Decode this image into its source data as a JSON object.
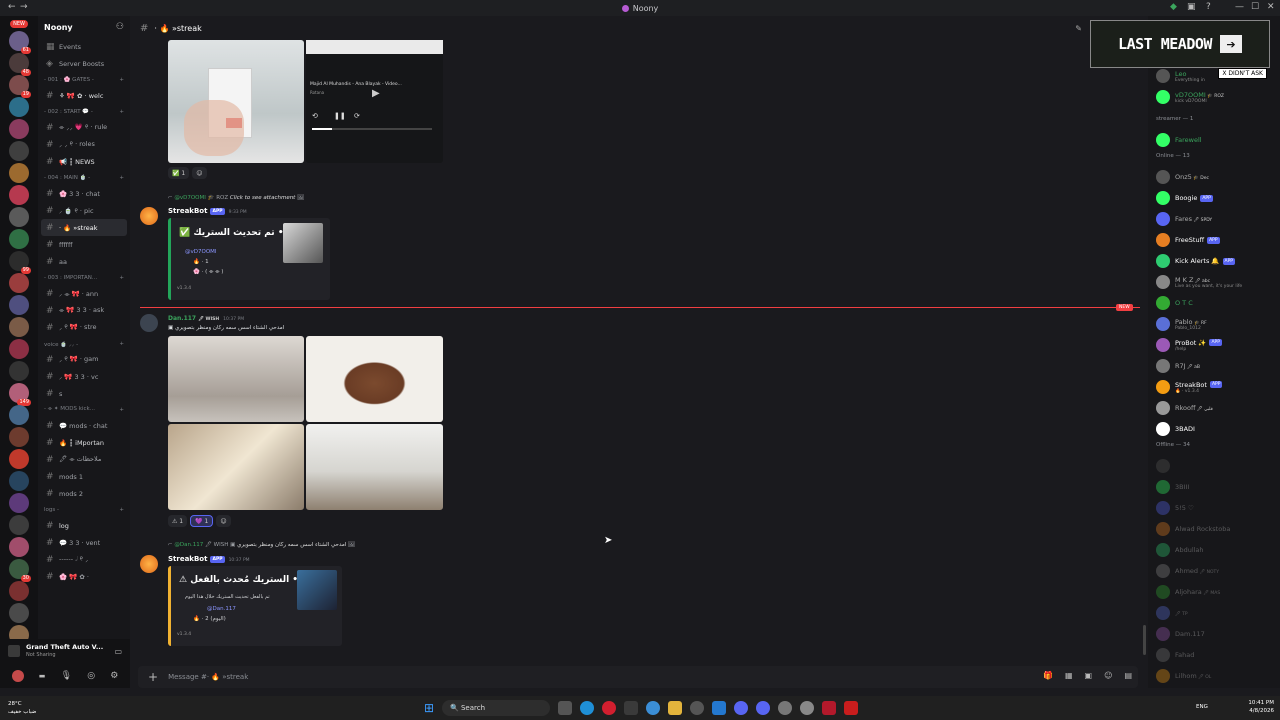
{
  "window": {
    "title": "Noony"
  },
  "rail": {
    "new_top": "NEW",
    "new_bottom": "NEW",
    "badges": [
      "61",
      "48",
      "19",
      "",
      "",
      "",
      "",
      "",
      "",
      "",
      "99",
      "",
      "",
      "",
      "",
      "",
      "149",
      "",
      "",
      "",
      "",
      "",
      "",
      "",
      "30",
      "",
      "",
      "",
      "",
      "110",
      "",
      "",
      "",
      "",
      "",
      "",
      "",
      "",
      "",
      "10",
      "",
      "",
      "",
      "",
      "",
      "",
      "",
      ""
    ]
  },
  "server": {
    "name": "Noony",
    "items": [
      {
        "icon": "calendar-icon",
        "label": "Events"
      },
      {
        "icon": "boost-icon",
        "label": "Server Boosts"
      }
    ],
    "categories": [
      {
        "title": "- 001 : 🌸 GATES -",
        "channels": [
          {
            "label": "⚘ 🎀 ✿ · welc",
            "bright": true
          }
        ]
      },
      {
        "title": "- 002 : START 💬 -",
        "channels": [
          {
            "label": "⌯ ⸝⸝ 💗 ୧ · rule"
          },
          {
            "label": "⸝ ⸝ ୧ · roles"
          },
          {
            "label": "📢 ┇ NEWS",
            "bright": true
          }
        ]
      },
      {
        "title": "- 004 : MAIN 🍵 -",
        "channels": [
          {
            "label": "🌸 3 3 · chat"
          },
          {
            "label": "⸝ 🍵 ୧ · pic"
          },
          {
            "label": "· 🔥 »streak",
            "active": true
          },
          {
            "label": "ffffff"
          },
          {
            "label": "aa"
          }
        ]
      },
      {
        "title": "- 003 : IMPORTAN...",
        "channels": [
          {
            "label": "⸝ ⌯ 🎀 · ann"
          },
          {
            "label": "⌯ 🎀 3 3 · ask"
          },
          {
            "label": "⸝ ୧ 🎀 · stre"
          }
        ]
      },
      {
        "title": "voice 🍵 ⸝⸝ -",
        "channels": [
          {
            "label": "⸝ ୧ 🎀 · gam"
          },
          {
            "label": "⸝ 🎀 3 3 · vc"
          },
          {
            "label": "s"
          }
        ]
      },
      {
        "title": "- ⌯ ✦ MODS kick...",
        "channels": [
          {
            "label": "💬 mods · chat"
          },
          {
            "label": "🔥 ┇ iMportan",
            "bright": true
          },
          {
            "label": "🖊 ⌯ ملاحظات"
          },
          {
            "label": "mods 1"
          },
          {
            "label": "mods 2"
          }
        ]
      },
      {
        "title": "logs -",
        "channels": [
          {
            "label": "log",
            "bright": true
          },
          {
            "label": "💬 3 3 · vent"
          },
          {
            "label": "------ 𝆹𝅥 ୧ ⸝"
          },
          {
            "label": "🌸 🎀 ✿ ·"
          }
        ]
      }
    ]
  },
  "activity": {
    "title": "Grand Theft Auto V...",
    "sub": "Not Sharing"
  },
  "channel": {
    "name": "· 🔥 »streak"
  },
  "messages": {
    "reaction1": {
      "emoji": "✅",
      "count": "1"
    },
    "m1": {
      "reply_user": "@vD7OOMI",
      "reply_tag": "🎓 ROZ",
      "reply_text": "Click to see attachment",
      "bot": "StreakBot",
      "app": "APP",
      "time": "9:33 PM",
      "title": "✅ تم تحديث الستريك •",
      "mention": "@vD7OOMI",
      "line1": "🔥 · 1",
      "line2": "🌸 · (  ⌯ ⌯  )",
      "version": "v1.3.4"
    },
    "video_caption": {
      "line1": "Majid Al Muhandis - Ana Blayak - Video...",
      "line2": "Rotana"
    },
    "m2": {
      "user": "Dan.117",
      "tag": "🖊 WISH",
      "time": "10:37 PM",
      "text": "امدحي الشتاء اسس سمه ركان ومنظر بتصويري",
      "reactions": [
        {
          "emoji": "⚠",
          "count": "1"
        },
        {
          "emoji": "💜",
          "count": "1"
        }
      ]
    },
    "m3": {
      "reply_user": "@Dan.117",
      "reply_tag": "🖊 WISH",
      "reply_text": "امدحي الشتاء اسس سمه ركان ومنظر بتصويري",
      "bot": "StreakBot",
      "app": "APP",
      "time": "10:37 PM",
      "title": "⚠ الستريك مُحدث بالفعل •",
      "desc": "تم بالفعل تحديث الستريك خلال هذا اليوم",
      "mention": "@Dan.117",
      "line2": "🔥 · 2 (اليوم)",
      "version": "v1.3.4"
    },
    "new_badge": "NEW"
  },
  "input": {
    "placeholder": "Message #· 🔥 »streak"
  },
  "overlay": {
    "title": "LAST MEADOW",
    "tooltip": "X DIDN'T ASK"
  },
  "members": {
    "top": [
      {
        "name": "Leo",
        "sub": "Everything in",
        "color": "#3ba55d"
      },
      {
        "name": "vD7OOMI",
        "tag": "🎓 ROZ",
        "sub": "kick vD7OOMI",
        "color": "#3ba55d"
      }
    ],
    "streamer_head": "streamer — 1",
    "streamer": [
      {
        "name": "Farewell",
        "color": "#3ba55d"
      }
    ],
    "online_head": "Online — 13",
    "online": [
      {
        "name": "Onz5",
        "tag": "🎓 Dec",
        "color": "#aaaaaa"
      },
      {
        "name": "Boogie",
        "app": "APP",
        "color": "#ffffff"
      },
      {
        "name": "Fares",
        "tag": "🖊 SPDY",
        "color": "#aaaaaa"
      },
      {
        "name": "FreeStuff",
        "app": "APP",
        "color": "#ffffff"
      },
      {
        "name": "Kick Alerts 🔔",
        "app": "APP",
        "color": "#ffffff"
      },
      {
        "name": "M K Z",
        "tag": "🖊 abc",
        "sub": "Live as you want, it's your life",
        "color": "#aaaaaa"
      },
      {
        "name": "O T C",
        "color": "#3ba55d"
      },
      {
        "name": "Pablo",
        "tag": "🎓 RF",
        "sub": "Pablo_1012",
        "color": "#aaaaaa"
      },
      {
        "name": "ProBot ✨",
        "app": "APP",
        "sub": "/help",
        "color": "#ffffff"
      },
      {
        "name": "R7J",
        "tag": "🖊 aB",
        "color": "#aaaaaa"
      },
      {
        "name": "StreakBot",
        "app": "APP",
        "sub": "🔥 · v1.3.4",
        "color": "#ffffff"
      },
      {
        "name": "Rkooff",
        "tag": "🖊 قلبي",
        "color": "#aaaaaa"
      },
      {
        "name": "3BADI",
        "color": "#ffffff"
      }
    ],
    "offline_head": "Offline — 34",
    "offline": [
      {
        "name": ""
      },
      {
        "name": "3BIII"
      },
      {
        "name": "5!5 ♡"
      },
      {
        "name": "Alwad Rockstoba"
      },
      {
        "name": "Abdullah"
      },
      {
        "name": "Ahmed",
        "tag": "🖊 NOTY"
      },
      {
        "name": "Aljohara",
        "tag": "🖊 MAS"
      },
      {
        "name": "",
        "tag": "🖊 TP"
      },
      {
        "name": "Dam.117"
      },
      {
        "name": "Fahad"
      },
      {
        "name": "Lilhom",
        "tag": "🖊 OL"
      }
    ]
  },
  "taskbar": {
    "weather": "28°C",
    "weather_sub": "ضباب خفيف",
    "search": "Search",
    "lang": "ENG",
    "time": "10:41 PM",
    "date": "4/8/2026"
  }
}
